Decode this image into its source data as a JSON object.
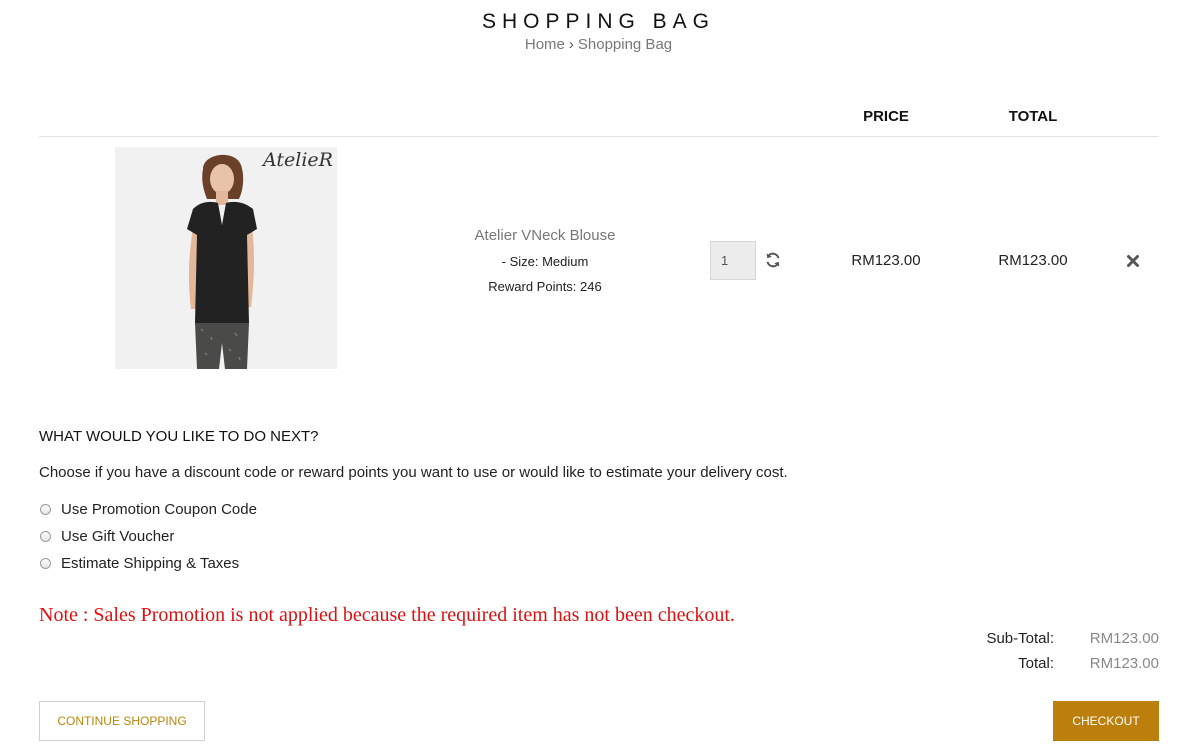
{
  "page": {
    "title": "SHOPPING BAG",
    "breadcrumb": {
      "home": "Home",
      "separator": "›",
      "current": "Shopping Bag"
    }
  },
  "table": {
    "headers": {
      "price": "PRICE",
      "total": "TOTAL"
    }
  },
  "item": {
    "image_brand": "AtelieR",
    "name": "Atelier VNeck Blouse",
    "option": "- Size: Medium",
    "reward_points": "Reward Points: 246",
    "quantity": "1",
    "unit_price": "RM123.00",
    "total_price": "RM123.00",
    "update_icon": "refresh-icon",
    "remove_icon": "close-icon"
  },
  "next_steps": {
    "heading": "WHAT WOULD YOU LIKE TO DO NEXT?",
    "description": "Choose if you have a discount code or reward points you want to use or would like to estimate your delivery cost.",
    "options": [
      {
        "label": "Use Promotion Coupon Code",
        "selected": false
      },
      {
        "label": "Use Gift Voucher",
        "selected": false
      },
      {
        "label": "Estimate Shipping & Taxes",
        "selected": false
      }
    ]
  },
  "note": "Note : Sales Promotion is not applied because the required item has not been checkout.",
  "totals": {
    "subtotal_label": "Sub-Total:",
    "subtotal_value": "RM123.00",
    "total_label": "Total:",
    "total_value": "RM123.00"
  },
  "buttons": {
    "continue": "CONTINUE SHOPPING",
    "checkout": "CHECKOUT"
  },
  "colors": {
    "accent": "#bd7f0c",
    "note_red": "#e01010",
    "muted_text": "#888888"
  }
}
